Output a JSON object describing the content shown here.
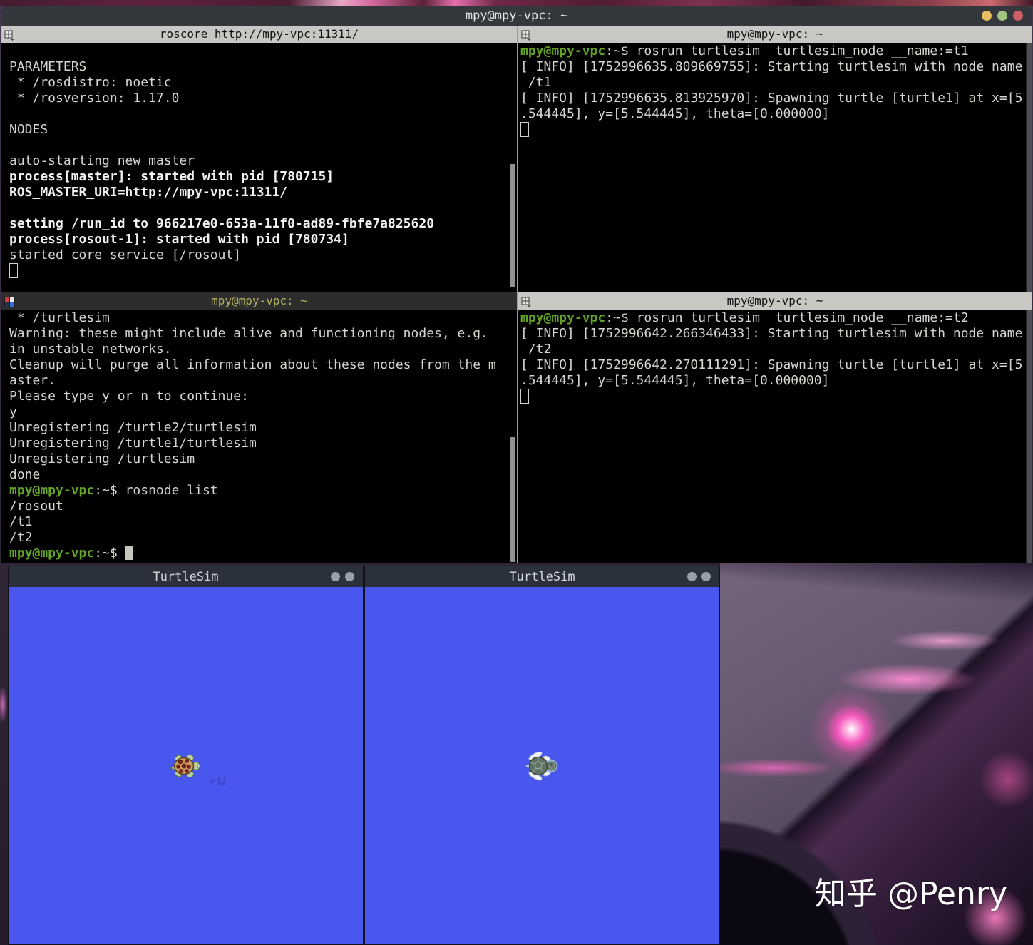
{
  "wallpaper": {
    "watermark": "知乎 @Penry"
  },
  "main_window": {
    "title": "mpy@mpy-vpc: ~",
    "controls": [
      "minimize",
      "maximize",
      "close"
    ]
  },
  "prompt": {
    "user": "mpy@mpy-vpc",
    "suffix": ":~$ "
  },
  "colors": {
    "turtlesim_canvas": "#4a57ee",
    "prompt_green": "#63a424",
    "focused_title_text": "#b3b05e",
    "window_buttons": [
      "#e7c05f",
      "#a2c483",
      "#cf5e6b"
    ]
  },
  "panes": [
    {
      "id": "roscore",
      "title": "roscore http://mpy-vpc:11311/",
      "focused": false,
      "lines": [
        {
          "t": ""
        },
        {
          "t": "PARAMETERS"
        },
        {
          "t": " * /rosdistro: noetic"
        },
        {
          "t": " * /rosversion: 1.17.0"
        },
        {
          "t": ""
        },
        {
          "t": "NODES"
        },
        {
          "t": ""
        },
        {
          "t": "auto-starting new master"
        },
        {
          "t": "process[master]: started with pid [780715]",
          "b": true
        },
        {
          "t": "ROS_MASTER_URI=http://mpy-vpc:11311/",
          "b": true
        },
        {
          "t": ""
        },
        {
          "t": "setting /run_id to 966217e0-653a-11f0-ad89-fbfe7a825620",
          "b": true
        },
        {
          "t": "process[rosout-1]: started with pid [780734]",
          "b": true
        },
        {
          "t": "started core service [/rosout]"
        },
        {
          "cur": "hollow"
        }
      ]
    },
    {
      "id": "turtle1-node",
      "title": "mpy@mpy-vpc: ~",
      "focused": false,
      "lines": [
        {
          "p": true,
          "t": "rosrun turtlesim  turtlesim_node __name:=t1"
        },
        {
          "t": "[ INFO] [1752996635.809669755]: Starting turtlesim with node name"
        },
        {
          "t": " /t1"
        },
        {
          "t": "[ INFO] [1752996635.813925970]: Spawning turtle [turtle1] at x=[5"
        },
        {
          "t": ".544445], y=[5.544445], theta=[0.000000]"
        },
        {
          "cur": "hollow"
        }
      ]
    },
    {
      "id": "cleanup",
      "title": "mpy@mpy-vpc: ~",
      "focused": true,
      "lines": [
        {
          "t": " * /turtlesim"
        },
        {
          "t": "Warning: these might include alive and functioning nodes, e.g."
        },
        {
          "t": "in unstable networks."
        },
        {
          "t": "Cleanup will purge all information about these nodes from the m"
        },
        {
          "t": "aster."
        },
        {
          "t": "Please type y or n to continue:"
        },
        {
          "t": "y"
        },
        {
          "t": "Unregistering /turtle2/turtlesim"
        },
        {
          "t": "Unregistering /turtle1/turtlesim"
        },
        {
          "t": "Unregistering /turtlesim"
        },
        {
          "t": "done"
        },
        {
          "p": true,
          "t": "rosnode list"
        },
        {
          "t": "/rosout"
        },
        {
          "t": "/t1"
        },
        {
          "t": "/t2"
        },
        {
          "p": true,
          "t": "",
          "cur": "solid"
        }
      ]
    },
    {
      "id": "turtle2-node",
      "title": "mpy@mpy-vpc: ~",
      "focused": false,
      "lines": [
        {
          "p": true,
          "t": "rosrun turtlesim  turtlesim_node __name:=t2"
        },
        {
          "t": "[ INFO] [1752996642.266346433]: Starting turtlesim with node name"
        },
        {
          "t": " /t2"
        },
        {
          "t": "[ INFO] [1752996642.270111291]: Spawning turtle [turtle1] at x=[5"
        },
        {
          "t": ".544445], y=[5.544445], theta=[0.000000]"
        },
        {
          "cur": "hollow"
        }
      ]
    }
  ],
  "turtlesim_windows": [
    {
      "title": "TurtleSim"
    },
    {
      "title": "TurtleSim"
    }
  ]
}
